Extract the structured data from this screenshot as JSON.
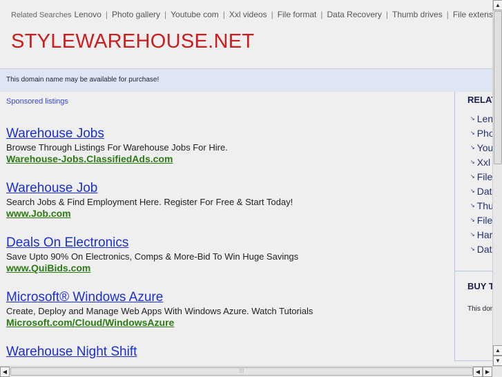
{
  "related_bar": {
    "label": "Related Searches",
    "links": [
      "Lenovo",
      "Photo gallery",
      "Youtube com",
      "Xxl videos",
      "File format",
      "Data Recovery",
      "Thumb drives",
      "File extensi"
    ]
  },
  "site_title": "STYLEWAREHOUSE.NET",
  "notice": "This domain name may be available for purchase!",
  "sponsored_label": "Sponsored listings",
  "ads": [
    {
      "title": "Warehouse Jobs",
      "desc": "Browse Through Listings For Warehouse Jobs For Hire.",
      "url": "Warehouse-Jobs.ClassifiedAds.com"
    },
    {
      "title": "Warehouse Job",
      "desc": "Search Jobs & Find Employment Here. Register For Free & Start Today!",
      "url": "www.Job.com"
    },
    {
      "title": "Deals On Electronics",
      "desc": "Save Upto 90% On Electronics, Comps & More-Bid To Win Huge Savings",
      "url": "www.QuiBids.com"
    },
    {
      "title": "Microsoft® Windows Azure",
      "desc": "Create, Deploy and Manage Web Apps With Windows Azure. Watch Tutorials",
      "url": "Microsoft.com/Cloud/WindowsAzure"
    },
    {
      "title": "Warehouse Night Shift",
      "desc": "",
      "url": ""
    }
  ],
  "sidebar": {
    "title": "RELAT",
    "items": [
      "Lenovo",
      "Photo gallery",
      "Youtube com",
      "Xxl videos",
      "File format",
      "Data Recovery",
      "Thumb drives",
      "File extensi",
      "Har",
      "Dat"
    ],
    "buy_title": "BUY T",
    "buy_text": "This dor"
  }
}
